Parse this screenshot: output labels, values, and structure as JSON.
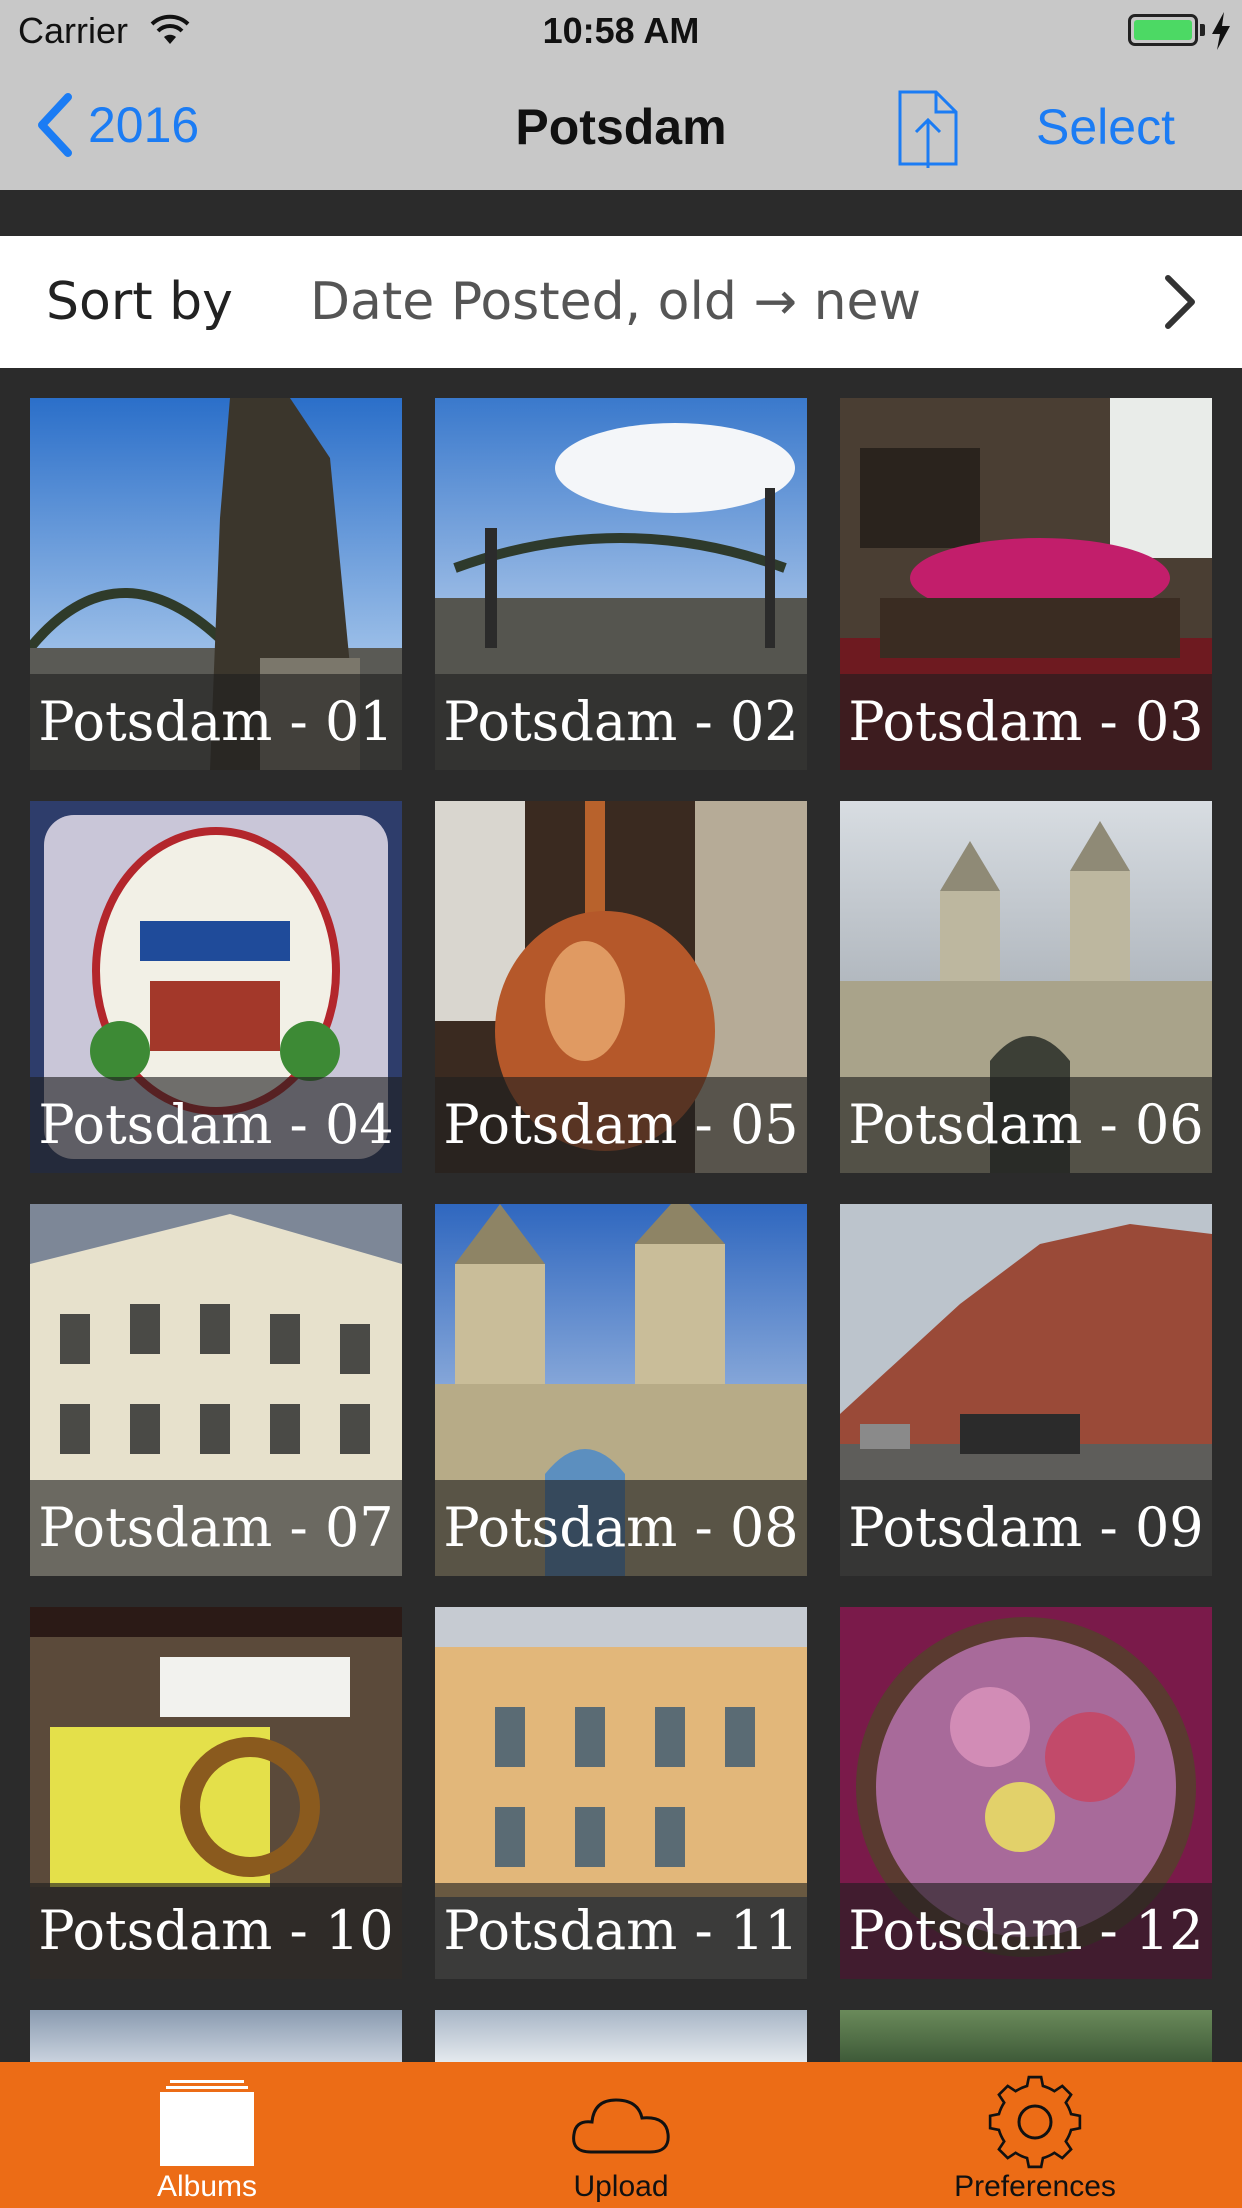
{
  "status_bar": {
    "carrier": "Carrier",
    "time": "10:58 AM"
  },
  "nav": {
    "back_label": "2016",
    "title": "Potsdam",
    "select_label": "Select"
  },
  "sort": {
    "label": "Sort by",
    "value": "Date Posted, old → new"
  },
  "albums": [
    {
      "caption": "Potsdam - 01"
    },
    {
      "caption": "Potsdam - 02"
    },
    {
      "caption": "Potsdam - 03"
    },
    {
      "caption": "Potsdam - 04"
    },
    {
      "caption": "Potsdam - 05"
    },
    {
      "caption": "Potsdam - 06"
    },
    {
      "caption": "Potsdam - 07"
    },
    {
      "caption": "Potsdam - 08"
    },
    {
      "caption": "Potsdam - 09"
    },
    {
      "caption": "Potsdam - 10"
    },
    {
      "caption": "Potsdam - 11"
    },
    {
      "caption": "Potsdam - 12"
    }
  ],
  "tabs": [
    {
      "label": "Albums",
      "icon": "albums-icon",
      "active": true
    },
    {
      "label": "Upload",
      "icon": "cloud-icon",
      "active": false
    },
    {
      "label": "Preferences",
      "icon": "gear-icon",
      "active": false
    }
  ],
  "colors": {
    "accent": "#1b7cf4",
    "tab_bar": "#ec6c16",
    "nav_bar": "#c8c8c8",
    "background": "#2b2b2b"
  }
}
